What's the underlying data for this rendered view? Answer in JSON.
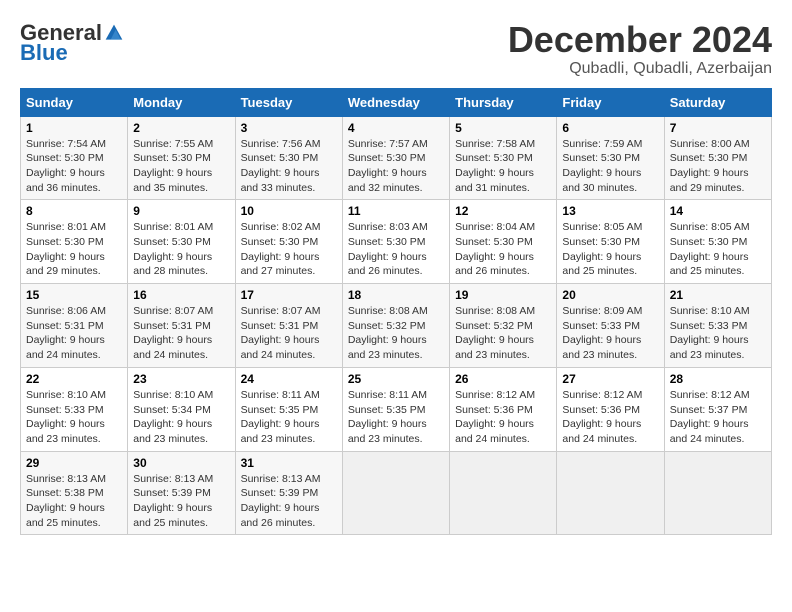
{
  "header": {
    "logo_general": "General",
    "logo_blue": "Blue",
    "month_title": "December 2024",
    "location": "Qubadli, Qubadli, Azerbaijan"
  },
  "calendar": {
    "days_of_week": [
      "Sunday",
      "Monday",
      "Tuesday",
      "Wednesday",
      "Thursday",
      "Friday",
      "Saturday"
    ],
    "weeks": [
      [
        {
          "day": "1",
          "info": "Sunrise: 7:54 AM\nSunset: 5:30 PM\nDaylight: 9 hours\nand 36 minutes."
        },
        {
          "day": "2",
          "info": "Sunrise: 7:55 AM\nSunset: 5:30 PM\nDaylight: 9 hours\nand 35 minutes."
        },
        {
          "day": "3",
          "info": "Sunrise: 7:56 AM\nSunset: 5:30 PM\nDaylight: 9 hours\nand 33 minutes."
        },
        {
          "day": "4",
          "info": "Sunrise: 7:57 AM\nSunset: 5:30 PM\nDaylight: 9 hours\nand 32 minutes."
        },
        {
          "day": "5",
          "info": "Sunrise: 7:58 AM\nSunset: 5:30 PM\nDaylight: 9 hours\nand 31 minutes."
        },
        {
          "day": "6",
          "info": "Sunrise: 7:59 AM\nSunset: 5:30 PM\nDaylight: 9 hours\nand 30 minutes."
        },
        {
          "day": "7",
          "info": "Sunrise: 8:00 AM\nSunset: 5:30 PM\nDaylight: 9 hours\nand 29 minutes."
        }
      ],
      [
        {
          "day": "8",
          "info": "Sunrise: 8:01 AM\nSunset: 5:30 PM\nDaylight: 9 hours\nand 29 minutes."
        },
        {
          "day": "9",
          "info": "Sunrise: 8:01 AM\nSunset: 5:30 PM\nDaylight: 9 hours\nand 28 minutes."
        },
        {
          "day": "10",
          "info": "Sunrise: 8:02 AM\nSunset: 5:30 PM\nDaylight: 9 hours\nand 27 minutes."
        },
        {
          "day": "11",
          "info": "Sunrise: 8:03 AM\nSunset: 5:30 PM\nDaylight: 9 hours\nand 26 minutes."
        },
        {
          "day": "12",
          "info": "Sunrise: 8:04 AM\nSunset: 5:30 PM\nDaylight: 9 hours\nand 26 minutes."
        },
        {
          "day": "13",
          "info": "Sunrise: 8:05 AM\nSunset: 5:30 PM\nDaylight: 9 hours\nand 25 minutes."
        },
        {
          "day": "14",
          "info": "Sunrise: 8:05 AM\nSunset: 5:30 PM\nDaylight: 9 hours\nand 25 minutes."
        }
      ],
      [
        {
          "day": "15",
          "info": "Sunrise: 8:06 AM\nSunset: 5:31 PM\nDaylight: 9 hours\nand 24 minutes."
        },
        {
          "day": "16",
          "info": "Sunrise: 8:07 AM\nSunset: 5:31 PM\nDaylight: 9 hours\nand 24 minutes."
        },
        {
          "day": "17",
          "info": "Sunrise: 8:07 AM\nSunset: 5:31 PM\nDaylight: 9 hours\nand 24 minutes."
        },
        {
          "day": "18",
          "info": "Sunrise: 8:08 AM\nSunset: 5:32 PM\nDaylight: 9 hours\nand 23 minutes."
        },
        {
          "day": "19",
          "info": "Sunrise: 8:08 AM\nSunset: 5:32 PM\nDaylight: 9 hours\nand 23 minutes."
        },
        {
          "day": "20",
          "info": "Sunrise: 8:09 AM\nSunset: 5:33 PM\nDaylight: 9 hours\nand 23 minutes."
        },
        {
          "day": "21",
          "info": "Sunrise: 8:10 AM\nSunset: 5:33 PM\nDaylight: 9 hours\nand 23 minutes."
        }
      ],
      [
        {
          "day": "22",
          "info": "Sunrise: 8:10 AM\nSunset: 5:33 PM\nDaylight: 9 hours\nand 23 minutes."
        },
        {
          "day": "23",
          "info": "Sunrise: 8:10 AM\nSunset: 5:34 PM\nDaylight: 9 hours\nand 23 minutes."
        },
        {
          "day": "24",
          "info": "Sunrise: 8:11 AM\nSunset: 5:35 PM\nDaylight: 9 hours\nand 23 minutes."
        },
        {
          "day": "25",
          "info": "Sunrise: 8:11 AM\nSunset: 5:35 PM\nDaylight: 9 hours\nand 23 minutes."
        },
        {
          "day": "26",
          "info": "Sunrise: 8:12 AM\nSunset: 5:36 PM\nDaylight: 9 hours\nand 24 minutes."
        },
        {
          "day": "27",
          "info": "Sunrise: 8:12 AM\nSunset: 5:36 PM\nDaylight: 9 hours\nand 24 minutes."
        },
        {
          "day": "28",
          "info": "Sunrise: 8:12 AM\nSunset: 5:37 PM\nDaylight: 9 hours\nand 24 minutes."
        }
      ],
      [
        {
          "day": "29",
          "info": "Sunrise: 8:13 AM\nSunset: 5:38 PM\nDaylight: 9 hours\nand 25 minutes."
        },
        {
          "day": "30",
          "info": "Sunrise: 8:13 AM\nSunset: 5:39 PM\nDaylight: 9 hours\nand 25 minutes."
        },
        {
          "day": "31",
          "info": "Sunrise: 8:13 AM\nSunset: 5:39 PM\nDaylight: 9 hours\nand 26 minutes."
        },
        {
          "day": "",
          "info": ""
        },
        {
          "day": "",
          "info": ""
        },
        {
          "day": "",
          "info": ""
        },
        {
          "day": "",
          "info": ""
        }
      ]
    ]
  }
}
